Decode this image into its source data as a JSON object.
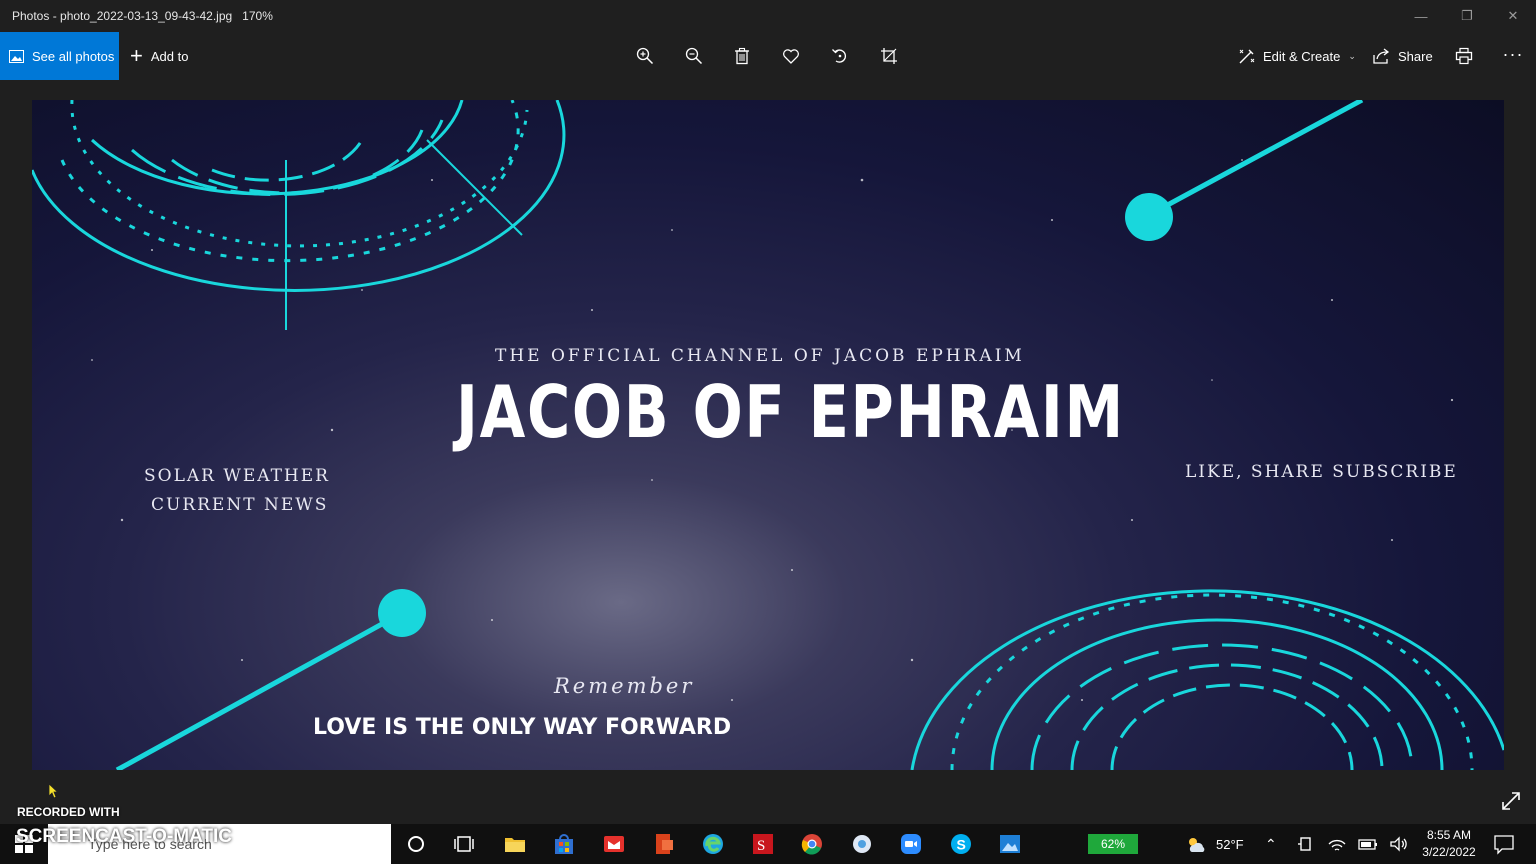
{
  "window": {
    "title": "Photos - photo_2022-03-13_09-43-42.jpg",
    "zoom": "170%",
    "minimize_icon": "minimize-icon",
    "restore_icon": "restore-icon",
    "close_icon": "close-icon"
  },
  "toolbar": {
    "see_all_photos": "See all photos",
    "add_to": "Add to",
    "tools": [
      "zoom-in-icon",
      "zoom-out-icon",
      "delete-icon",
      "favorite-icon",
      "rotate-icon",
      "crop-icon"
    ],
    "edit_create": "Edit & Create",
    "share": "Share",
    "print_icon": "print-icon",
    "more": "···"
  },
  "photo": {
    "subtitle": "THE OFFICIAL CHANNEL OF  JACOB EPHRAIM",
    "headline": "JACOB OF EPHRAIM",
    "left_line1": "SOLAR WEATHER",
    "left_line2": "CURRENT NEWS",
    "right_line": "LIKE, SHARE SUBSCRIBE",
    "remember": "Remember",
    "tagline": "LOVE IS THE ONLY WAY FORWARD",
    "accent_color": "#19d7dc"
  },
  "overlay": {
    "recorded_with": "RECORDED WITH",
    "brand": "SCREENCAST-O-MATIC"
  },
  "taskbar": {
    "search_placeholder": "Type here to search",
    "battery_app": "62%",
    "weather": "52°F",
    "time": "8:55 AM",
    "date": "3/22/2022"
  }
}
